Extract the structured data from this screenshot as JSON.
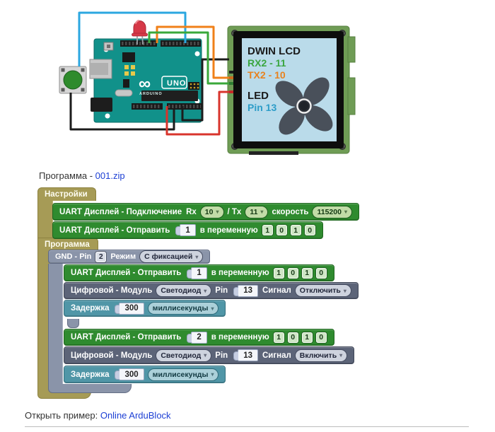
{
  "links": {
    "program_prefix": "Программа - ",
    "program_file": "001.zip",
    "example_prefix": "Открыть пример: ",
    "example_link": "Online ArduBlock"
  },
  "diagram": {
    "lcd": {
      "title": "DWIN LCD",
      "rx": "RX2 - 11",
      "tx": "TX2 - 10",
      "led": "LED",
      "pin": "Pin 13"
    },
    "arduino": {
      "model": "UNO",
      "brand": "ARDUINO",
      "logo": "∞"
    }
  },
  "colors": {
    "block_green": "#2f8b2f",
    "block_slate": "#8a94a9",
    "block_dark_slate": "#5c6478",
    "block_teal": "#5096a7",
    "frame_olive": "#a69b56",
    "link_blue": "#1c3fd4",
    "wire_blue": "#2ba7e0",
    "wire_green": "#3aa83a",
    "wire_orange": "#f08019",
    "wire_red": "#d8342c",
    "wire_black": "#1c1c1c",
    "lcd_screen": "#badbea",
    "lcd_rx_text": "#3aa63f",
    "lcd_tx_text": "#e8821e",
    "lcd_pin_text": "#2d9dc8"
  },
  "blocks": {
    "settings_tab": "Настройки",
    "program_tab": "Программа",
    "uart_connect": {
      "label": "UART Дисплей - Подключение",
      "rx_label": "Rx",
      "rx": "10",
      "tx_label": "/ Tx",
      "tx": "11",
      "speed_label": "скорость",
      "speed": "115200"
    },
    "uart_send_setup": {
      "label": "UART Дисплей - Отправить",
      "value": "1",
      "to_var": "в переменную",
      "vars": [
        "1",
        "0",
        "1",
        "0"
      ]
    },
    "gnd": {
      "label": "GND - Pin",
      "pin": "2",
      "mode_label": "Режим",
      "mode": "С фиксацией"
    },
    "uart_send_1": {
      "label": "UART Дисплей - Отправить",
      "value": "1",
      "to_var": "в переменную",
      "vars": [
        "1",
        "0",
        "1",
        "0"
      ]
    },
    "digital_1": {
      "label": "Цифровой - Модуль",
      "module": "Светодиод",
      "pin_label": "Pin",
      "pin": "13",
      "signal_label": "Сигнал",
      "signal": "Отключить"
    },
    "delay_1": {
      "label": "Задержка",
      "value": "300",
      "unit": "миллисекунды"
    },
    "uart_send_2": {
      "label": "UART Дисплей - Отправить",
      "value": "2",
      "to_var": "в переменную",
      "vars": [
        "1",
        "0",
        "1",
        "0"
      ]
    },
    "digital_2": {
      "label": "Цифровой - Модуль",
      "module": "Светодиод",
      "pin_label": "Pin",
      "pin": "13",
      "signal_label": "Сигнал",
      "signal": "Включить"
    },
    "delay_2": {
      "label": "Задержка",
      "value": "300",
      "unit": "миллисекунды"
    }
  }
}
